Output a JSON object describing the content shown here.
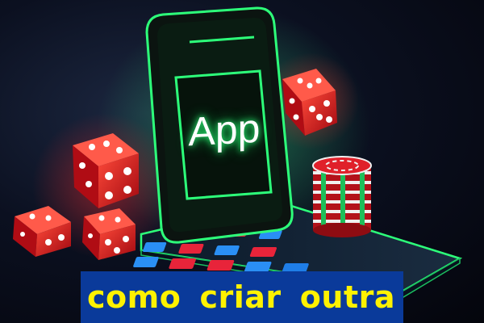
{
  "screen": {
    "label": "App"
  },
  "caption": {
    "words": [
      "como",
      "criar",
      "outra"
    ]
  },
  "colors": {
    "neon_green": "#2dff7a",
    "dice_red": "#e0141e",
    "chip_red": "#c8141c",
    "chip_white": "#f0f0f0",
    "caption_bg": "#0a3a9a",
    "caption_text": "#fff200"
  },
  "icons": [
    "dice-icon",
    "casino-chip-icon",
    "smartphone-icon"
  ]
}
